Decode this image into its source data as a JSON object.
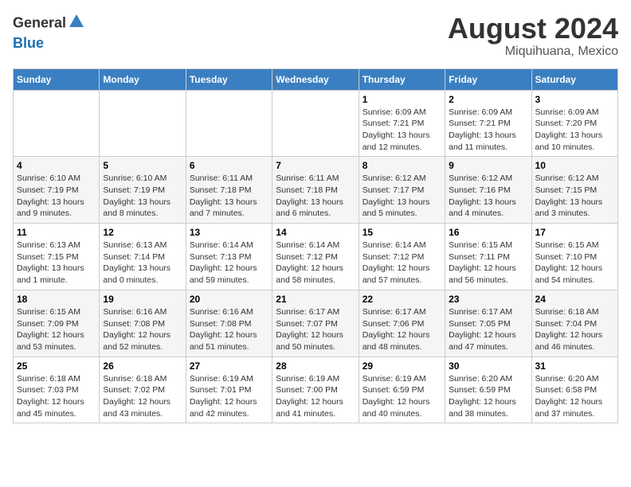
{
  "header": {
    "logo_line1": "General",
    "logo_line2": "Blue",
    "month_year": "August 2024",
    "location": "Miquihuana, Mexico"
  },
  "days_of_week": [
    "Sunday",
    "Monday",
    "Tuesday",
    "Wednesday",
    "Thursday",
    "Friday",
    "Saturday"
  ],
  "weeks": [
    [
      {
        "day": "",
        "info": ""
      },
      {
        "day": "",
        "info": ""
      },
      {
        "day": "",
        "info": ""
      },
      {
        "day": "",
        "info": ""
      },
      {
        "day": "1",
        "info": "Sunrise: 6:09 AM\nSunset: 7:21 PM\nDaylight: 13 hours and 12 minutes."
      },
      {
        "day": "2",
        "info": "Sunrise: 6:09 AM\nSunset: 7:21 PM\nDaylight: 13 hours and 11 minutes."
      },
      {
        "day": "3",
        "info": "Sunrise: 6:09 AM\nSunset: 7:20 PM\nDaylight: 13 hours and 10 minutes."
      }
    ],
    [
      {
        "day": "4",
        "info": "Sunrise: 6:10 AM\nSunset: 7:19 PM\nDaylight: 13 hours and 9 minutes."
      },
      {
        "day": "5",
        "info": "Sunrise: 6:10 AM\nSunset: 7:19 PM\nDaylight: 13 hours and 8 minutes."
      },
      {
        "day": "6",
        "info": "Sunrise: 6:11 AM\nSunset: 7:18 PM\nDaylight: 13 hours and 7 minutes."
      },
      {
        "day": "7",
        "info": "Sunrise: 6:11 AM\nSunset: 7:18 PM\nDaylight: 13 hours and 6 minutes."
      },
      {
        "day": "8",
        "info": "Sunrise: 6:12 AM\nSunset: 7:17 PM\nDaylight: 13 hours and 5 minutes."
      },
      {
        "day": "9",
        "info": "Sunrise: 6:12 AM\nSunset: 7:16 PM\nDaylight: 13 hours and 4 minutes."
      },
      {
        "day": "10",
        "info": "Sunrise: 6:12 AM\nSunset: 7:15 PM\nDaylight: 13 hours and 3 minutes."
      }
    ],
    [
      {
        "day": "11",
        "info": "Sunrise: 6:13 AM\nSunset: 7:15 PM\nDaylight: 13 hours and 1 minute."
      },
      {
        "day": "12",
        "info": "Sunrise: 6:13 AM\nSunset: 7:14 PM\nDaylight: 13 hours and 0 minutes."
      },
      {
        "day": "13",
        "info": "Sunrise: 6:14 AM\nSunset: 7:13 PM\nDaylight: 12 hours and 59 minutes."
      },
      {
        "day": "14",
        "info": "Sunrise: 6:14 AM\nSunset: 7:12 PM\nDaylight: 12 hours and 58 minutes."
      },
      {
        "day": "15",
        "info": "Sunrise: 6:14 AM\nSunset: 7:12 PM\nDaylight: 12 hours and 57 minutes."
      },
      {
        "day": "16",
        "info": "Sunrise: 6:15 AM\nSunset: 7:11 PM\nDaylight: 12 hours and 56 minutes."
      },
      {
        "day": "17",
        "info": "Sunrise: 6:15 AM\nSunset: 7:10 PM\nDaylight: 12 hours and 54 minutes."
      }
    ],
    [
      {
        "day": "18",
        "info": "Sunrise: 6:15 AM\nSunset: 7:09 PM\nDaylight: 12 hours and 53 minutes."
      },
      {
        "day": "19",
        "info": "Sunrise: 6:16 AM\nSunset: 7:08 PM\nDaylight: 12 hours and 52 minutes."
      },
      {
        "day": "20",
        "info": "Sunrise: 6:16 AM\nSunset: 7:08 PM\nDaylight: 12 hours and 51 minutes."
      },
      {
        "day": "21",
        "info": "Sunrise: 6:17 AM\nSunset: 7:07 PM\nDaylight: 12 hours and 50 minutes."
      },
      {
        "day": "22",
        "info": "Sunrise: 6:17 AM\nSunset: 7:06 PM\nDaylight: 12 hours and 48 minutes."
      },
      {
        "day": "23",
        "info": "Sunrise: 6:17 AM\nSunset: 7:05 PM\nDaylight: 12 hours and 47 minutes."
      },
      {
        "day": "24",
        "info": "Sunrise: 6:18 AM\nSunset: 7:04 PM\nDaylight: 12 hours and 46 minutes."
      }
    ],
    [
      {
        "day": "25",
        "info": "Sunrise: 6:18 AM\nSunset: 7:03 PM\nDaylight: 12 hours and 45 minutes."
      },
      {
        "day": "26",
        "info": "Sunrise: 6:18 AM\nSunset: 7:02 PM\nDaylight: 12 hours and 43 minutes."
      },
      {
        "day": "27",
        "info": "Sunrise: 6:19 AM\nSunset: 7:01 PM\nDaylight: 12 hours and 42 minutes."
      },
      {
        "day": "28",
        "info": "Sunrise: 6:19 AM\nSunset: 7:00 PM\nDaylight: 12 hours and 41 minutes."
      },
      {
        "day": "29",
        "info": "Sunrise: 6:19 AM\nSunset: 6:59 PM\nDaylight: 12 hours and 40 minutes."
      },
      {
        "day": "30",
        "info": "Sunrise: 6:20 AM\nSunset: 6:59 PM\nDaylight: 12 hours and 38 minutes."
      },
      {
        "day": "31",
        "info": "Sunrise: 6:20 AM\nSunset: 6:58 PM\nDaylight: 12 hours and 37 minutes."
      }
    ]
  ]
}
